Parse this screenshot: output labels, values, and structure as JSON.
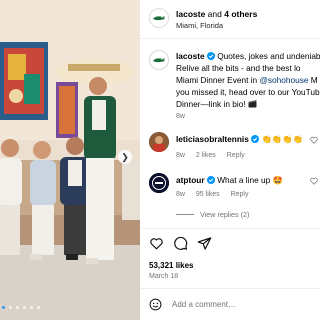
{
  "post": {
    "header": {
      "username": "lacoste",
      "connector": "and",
      "others": "4 others",
      "location": "Miami, Florida",
      "avatar_icon": "lacoste-crocodile-logo"
    },
    "caption": {
      "username": "lacoste",
      "lines": [
        "Quotes, jokes and undeniab",
        "Relive all the bits - and the best lo",
        "Miami Dinner Event in ",
        "you missed it, head over to our YouTub",
        "Dinner—link in bio! "
      ],
      "mention": "@sohohouse",
      "line3_tail": " M",
      "age": "8w"
    },
    "comments": [
      {
        "username": "leticiasobraltennis",
        "text": "👏👏👏👏",
        "age": "8w",
        "likes": "2 likes",
        "reply": "Reply"
      },
      {
        "username": "atptour",
        "text": "What a line up 🤩",
        "age": "8w",
        "likes": "95 likes",
        "reply": "Reply",
        "view_replies": "View replies (2)"
      }
    ],
    "likes": "53,321 likes",
    "date": "March 18",
    "add_comment_placeholder": "Add a comment…",
    "colors": {
      "link": "#00376b",
      "muted": "#737373",
      "verified": "#0095f6",
      "accent": "#3897f0"
    },
    "carousel": {
      "dots": 6,
      "active": 0
    }
  }
}
